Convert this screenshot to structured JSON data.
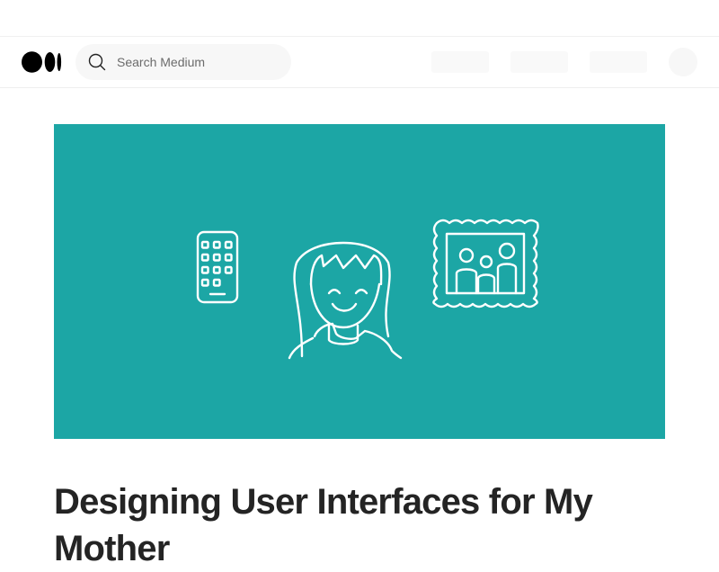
{
  "search": {
    "placeholder": "Search Medium"
  },
  "article": {
    "title": "Designing User Interfaces for My Mother"
  },
  "colors": {
    "hero_background": "#1ca6a5",
    "text_primary": "#242424"
  },
  "icons": [
    "medium-logo",
    "search-icon",
    "phone-icon",
    "girl-icon",
    "family-picture-icon"
  ]
}
